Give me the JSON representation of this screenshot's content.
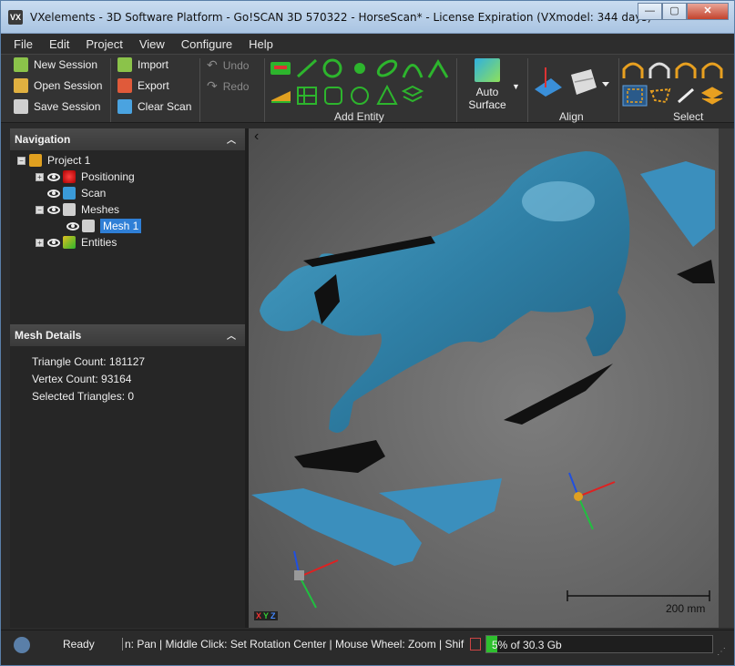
{
  "window": {
    "title": "VXelements - 3D Software Platform - Go!SCAN 3D 570322 - HorseScan* - License Expiration (VXmodel: 344 days)",
    "app_icon_text": "VX"
  },
  "menu": [
    "File",
    "Edit",
    "Project",
    "View",
    "Configure",
    "Help"
  ],
  "ribbon": {
    "session": {
      "new": "New Session",
      "open": "Open Session",
      "save": "Save Session"
    },
    "file": {
      "import": "Import",
      "export": "Export",
      "clear": "Clear Scan"
    },
    "history": {
      "undo": "Undo",
      "redo": "Redo"
    },
    "add_entity_label": "Add Entity",
    "auto_surface_line1": "Auto",
    "auto_surface_line2": "Surface",
    "align_label": "Align",
    "select_label": "Select"
  },
  "navigation": {
    "title": "Navigation",
    "project": "Project 1",
    "items": [
      {
        "label": "Positioning"
      },
      {
        "label": "Scan"
      },
      {
        "label": "Meshes"
      },
      {
        "label": "Mesh 1"
      },
      {
        "label": "Entities"
      }
    ]
  },
  "mesh_details": {
    "title": "Mesh Details",
    "triangle_count": "Triangle Count: 181127",
    "vertex_count": "Vertex Count: 93164",
    "selected_triangles": "Selected Triangles: 0"
  },
  "viewport": {
    "scale_label": "200 mm",
    "axis_x": "X",
    "axis_y": "Y",
    "axis_z": "Z",
    "back_arrow": "‹"
  },
  "status": {
    "state": "Ready",
    "hint": "n: Pan  |  Middle Click: Set Rotation Center  |  Mouse Wheel: Zoom  |  Shif",
    "memory": "5% of 30.3 Gb",
    "memory_fraction": 0.05
  },
  "colors": {
    "mesh": "#2f7fa5",
    "mesh_light": "#4aa3c9",
    "accent": "#2ec02e"
  }
}
